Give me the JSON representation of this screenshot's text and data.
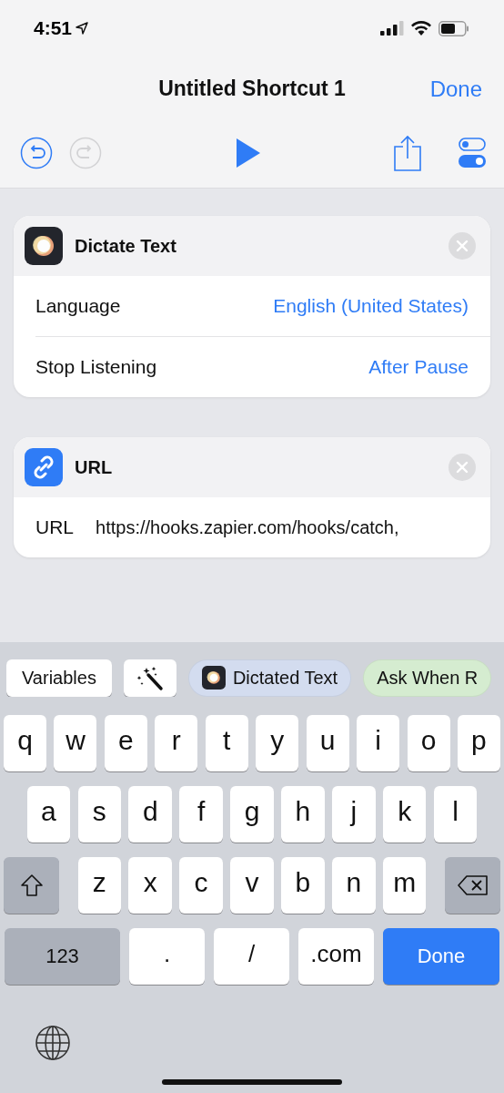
{
  "status_bar": {
    "time": "4:51"
  },
  "nav": {
    "title": "Untitled Shortcut 1",
    "done": "Done"
  },
  "toolbar": [
    {
      "kind": "undo",
      "disabled": false
    },
    {
      "kind": "redo",
      "disabled": true
    },
    {
      "kind": "play",
      "disabled": false
    },
    {
      "kind": "share",
      "disabled": false
    },
    {
      "kind": "settings",
      "disabled": false
    }
  ],
  "actions": [
    {
      "kind": "dictate",
      "title": "Dictate Text",
      "fields": [
        {
          "label": "Language",
          "value": "English (United States)",
          "kind": "option"
        },
        {
          "label": "Stop Listening",
          "value": "After Pause",
          "kind": "option"
        }
      ]
    },
    {
      "kind": "link",
      "title": "URL",
      "fields": [
        {
          "label": "URL",
          "value": "https://hooks.zapier.com/hooks/catch,",
          "kind": "text"
        }
      ]
    }
  ],
  "suggestions": [
    {
      "kind": "button",
      "label": "Variables"
    },
    {
      "kind": "magic"
    },
    {
      "kind": "variable",
      "label": "Dictated Text",
      "color": "#d3dcef"
    },
    {
      "kind": "variable",
      "label": "Ask When R",
      "color": "#d5ecd0"
    }
  ],
  "keyboard": [
    [
      {
        "kind": "letter",
        "label": "q"
      },
      {
        "kind": "letter",
        "label": "w"
      },
      {
        "kind": "letter",
        "label": "e"
      },
      {
        "kind": "letter",
        "label": "r"
      },
      {
        "kind": "letter",
        "label": "t"
      },
      {
        "kind": "letter",
        "label": "y"
      },
      {
        "kind": "letter",
        "label": "u"
      },
      {
        "kind": "letter",
        "label": "i"
      },
      {
        "kind": "letter",
        "label": "o"
      },
      {
        "kind": "letter",
        "label": "p"
      }
    ],
    [
      {
        "kind": "letter",
        "label": "a"
      },
      {
        "kind": "letter",
        "label": "s"
      },
      {
        "kind": "letter",
        "label": "d"
      },
      {
        "kind": "letter",
        "label": "f"
      },
      {
        "kind": "letter",
        "label": "g"
      },
      {
        "kind": "letter",
        "label": "h"
      },
      {
        "kind": "letter",
        "label": "j"
      },
      {
        "kind": "letter",
        "label": "k"
      },
      {
        "kind": "letter",
        "label": "l"
      }
    ],
    [
      {
        "kind": "shift"
      },
      {
        "kind": "letter",
        "label": "z"
      },
      {
        "kind": "letter",
        "label": "x"
      },
      {
        "kind": "letter",
        "label": "c"
      },
      {
        "kind": "letter",
        "label": "v"
      },
      {
        "kind": "letter",
        "label": "b"
      },
      {
        "kind": "letter",
        "label": "n"
      },
      {
        "kind": "letter",
        "label": "m"
      },
      {
        "kind": "delete"
      }
    ],
    [
      {
        "kind": "mode",
        "label": "123"
      },
      {
        "kind": "symbol",
        "label": "."
      },
      {
        "kind": "symbol",
        "label": "/"
      },
      {
        "kind": "symbol",
        "label": ".com"
      },
      {
        "kind": "done",
        "label": "Done"
      }
    ]
  ]
}
